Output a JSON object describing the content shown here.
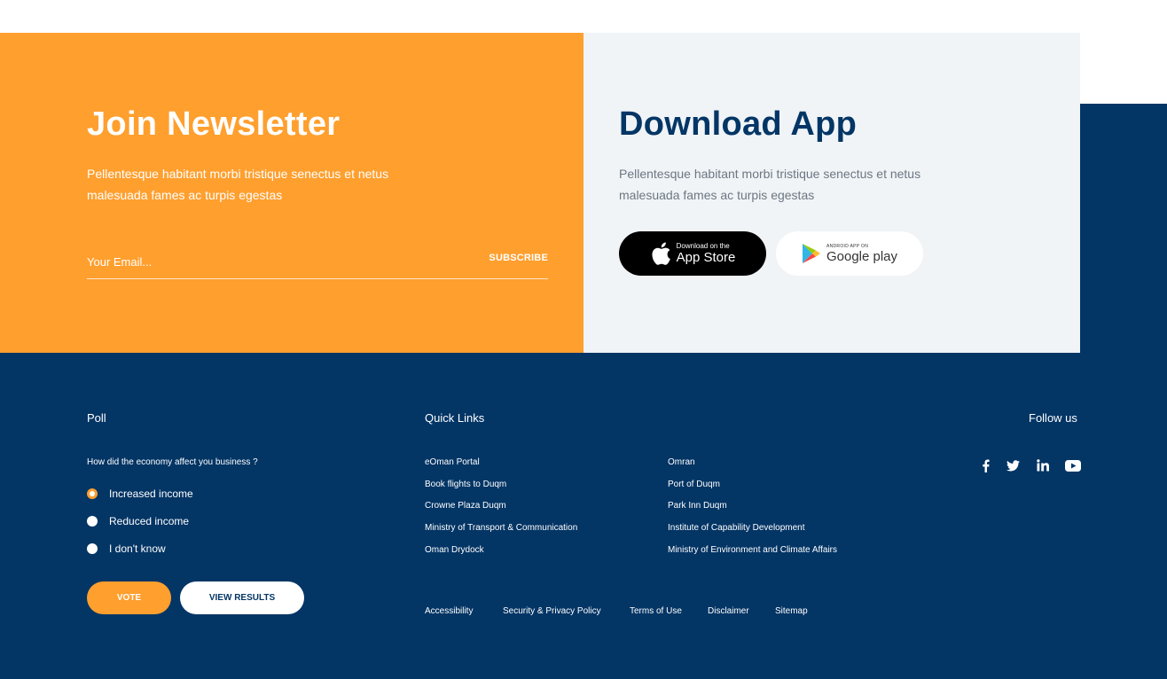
{
  "newsletter": {
    "title": "Join Newsletter",
    "description": "Pellentesque habitant morbi tristique senectus et netus malesuada fames ac turpis egestas",
    "email_placeholder": "Your Email...",
    "subscribe_label": "SUBSCRIBE"
  },
  "app": {
    "title": "Download App",
    "description": "Pellentesque habitant morbi tristique senectus et netus malesuada fames ac turpis egestas",
    "appstore_small": "Download on the",
    "appstore_big": "App Store",
    "gplay_small": "ANDROID APP ON",
    "gplay_big": "Google play"
  },
  "poll": {
    "title": "Poll",
    "question": "How did the economy affect you business ?",
    "options": [
      {
        "label": "Increased income",
        "selected": true
      },
      {
        "label": "Reduced income",
        "selected": false
      },
      {
        "label": "I don't know",
        "selected": false
      }
    ],
    "vote_label": "VOTE",
    "results_label": "VIEW RESULTS"
  },
  "quick_links": {
    "title": "Quick Links",
    "column1": [
      "eOman Portal",
      "Book flights to Duqm",
      "Crowne Plaza Duqm",
      "Ministry of Transport & Communication",
      "Oman Drydock"
    ],
    "column2": [
      "Omran",
      "Port of Duqm",
      "Park Inn Duqm",
      "Institute of Capability Development",
      "Ministry of Environment and Climate Affairs"
    ]
  },
  "bottom_links": [
    "Accessibility",
    "Security & Privacy Policy",
    "Terms of Use",
    "Disclaimer",
    "Sitemap"
  ],
  "follow": {
    "title": "Follow us",
    "icons": [
      "facebook-icon",
      "twitter-icon",
      "linkedin-icon",
      "youtube-icon"
    ]
  },
  "colors": {
    "orange": "#ff9f2e",
    "navy": "#033565",
    "panel": "#f0f4f7"
  }
}
